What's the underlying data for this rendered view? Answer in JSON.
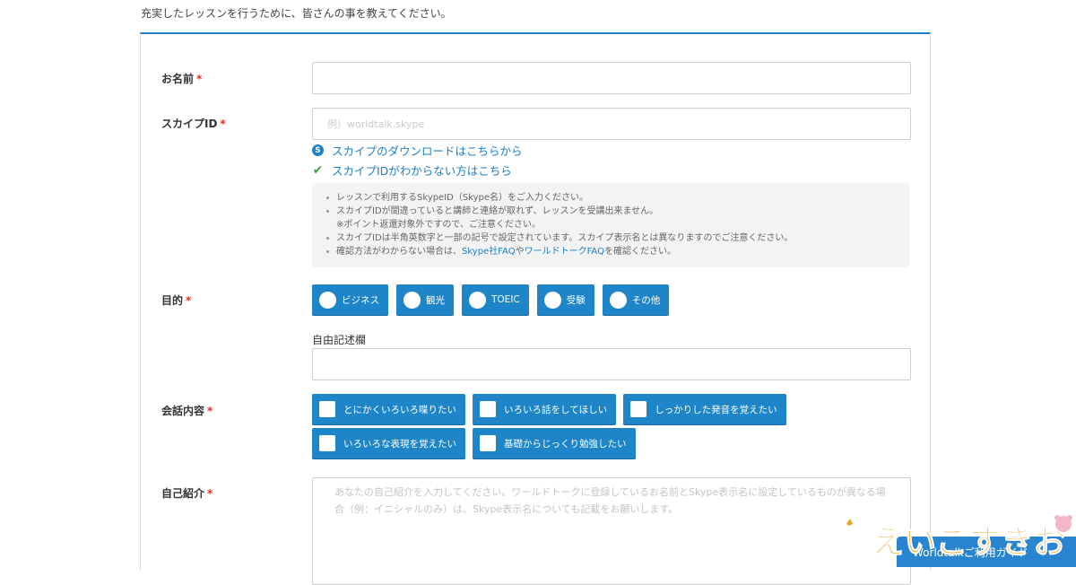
{
  "intro_text": "充実したレッスンを行うために、皆さんの事を教えてください。",
  "required_mark": "*",
  "name": {
    "label": "お名前",
    "value": ""
  },
  "skype": {
    "label": "スカイプID",
    "placeholder": "例）worldtalk.skype",
    "download_link": "スカイプのダウンロードはこちらから",
    "help_link": "スカイプIDがわからない方はこちら",
    "notes": [
      "レッスンで利用するSkypeID（Skype名）をご入力ください。",
      "スカイプIDが間違っていると講師と連絡が取れず、レッスンを受講出来ません。",
      "※ポイント返還対象外ですので、ご注意ください。",
      "スカイプIDは半角英数字と一部の記号で設定されています。スカイプ表示名とは異なりますのでご注意ください。"
    ],
    "last_note": {
      "prefix": "確認方法がわからない場合は、",
      "link1": "Skype社FAQ",
      "middle": "や",
      "link2": "ワールドトークFAQ",
      "suffix": "を確認ください。"
    }
  },
  "purpose": {
    "label": "目的",
    "options": [
      "ビジネス",
      "観光",
      "TOEIC",
      "受験",
      "その他"
    ],
    "free_label": "自由記述欄",
    "free_value": ""
  },
  "conversation": {
    "label": "会話内容",
    "options_row1": [
      "とにかくいろいろ喋りたい",
      "いろいろ話をしてほしい",
      "しっかりした発音を覚えたい"
    ],
    "options_row2": [
      "いろいろな表現を覚えたい",
      "基礎からじっくり勉強したい"
    ]
  },
  "self_intro": {
    "label": "自己紹介",
    "placeholder": "あなたの自己紹介を入力してください。ワールドトークに登録しているお名前とSkype表示名に設定しているものが異なる場合（例：イニシャルのみ）は、Skype表示名についても記載をお願いします。"
  },
  "guide_button": "Worldtalkご利用ガイド",
  "logo_text": "えいごすきお",
  "colors": {
    "accent": "#1e86c8",
    "link": "#1e7fc6",
    "required": "#d9302a",
    "check_green": "#3aa541"
  }
}
